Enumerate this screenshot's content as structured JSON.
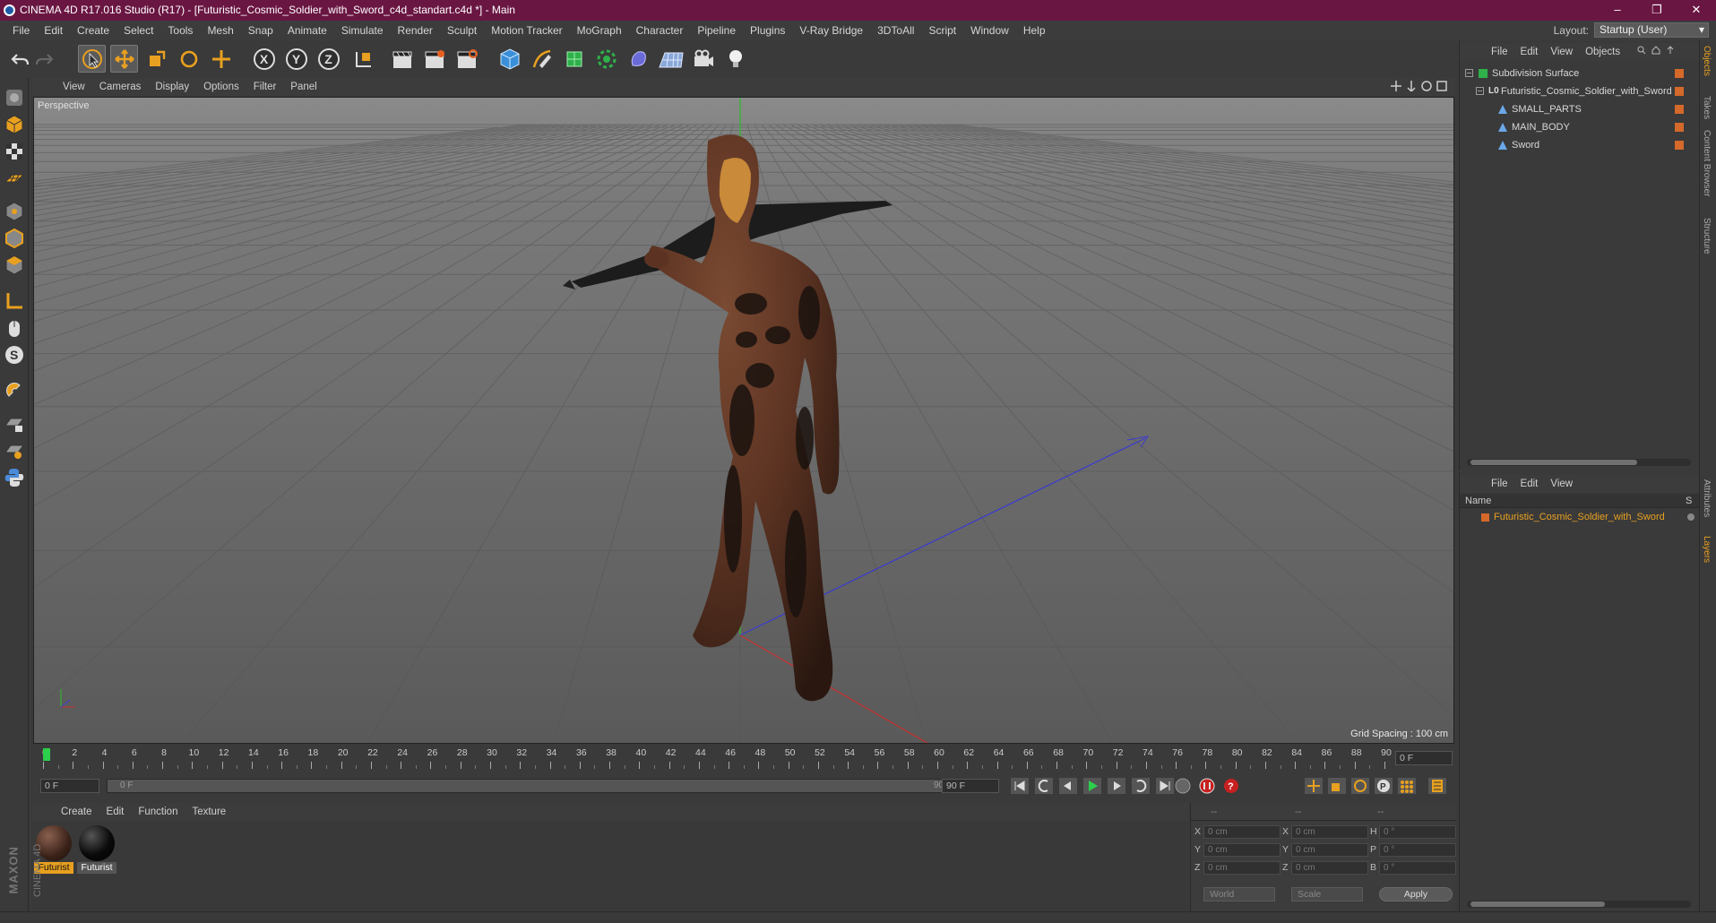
{
  "window": {
    "title": "CINEMA 4D R17.016 Studio (R17) - [Futuristic_Cosmic_Soldier_with_Sword_c4d_standart.c4d *] - Main",
    "controls": [
      "–",
      "❐",
      "✕"
    ]
  },
  "menubar": [
    "File",
    "Edit",
    "Create",
    "Select",
    "Tools",
    "Mesh",
    "Snap",
    "Animate",
    "Simulate",
    "Render",
    "Sculpt",
    "Motion Tracker",
    "MoGraph",
    "Character",
    "Pipeline",
    "Plugins",
    "V-Ray Bridge",
    "3DToAll",
    "Script",
    "Window",
    "Help"
  ],
  "layout": {
    "label": "Layout:",
    "value": "Startup (User)"
  },
  "toolbar": {
    "axis_x": "X",
    "axis_y": "Y",
    "axis_z": "Z"
  },
  "viewport": {
    "menu": [
      "View",
      "Cameras",
      "Display",
      "Options",
      "Filter",
      "Panel"
    ],
    "label": "Perspective",
    "grid_spacing": "Grid Spacing : 100 cm"
  },
  "timeline": {
    "ticks": [
      "0",
      "2",
      "4",
      "6",
      "8",
      "10",
      "12",
      "14",
      "16",
      "18",
      "20",
      "22",
      "24",
      "26",
      "28",
      "30",
      "32",
      "34",
      "36",
      "38",
      "40",
      "42",
      "44",
      "46",
      "48",
      "50",
      "52",
      "54",
      "56",
      "58",
      "60",
      "62",
      "64",
      "66",
      "68",
      "70",
      "72",
      "74",
      "76",
      "78",
      "80",
      "82",
      "84",
      "86",
      "88",
      "90"
    ],
    "current_frame": "0 F"
  },
  "anim": {
    "start": "0 F",
    "range_start": "0 F",
    "range_end": "90 F",
    "end": "90 F"
  },
  "materials": {
    "menu": [
      "Create",
      "Edit",
      "Function",
      "Texture"
    ],
    "items": [
      {
        "label": "Futurist",
        "selected": true
      },
      {
        "label": "Futurist",
        "selected": false
      }
    ]
  },
  "coords": {
    "header": [
      "--",
      "--",
      "--"
    ],
    "rows": [
      {
        "a": "X",
        "av": "0 cm",
        "b": "X",
        "bv": "0 cm",
        "c": "H",
        "cv": "0 °"
      },
      {
        "a": "Y",
        "av": "0 cm",
        "b": "Y",
        "bv": "0 cm",
        "c": "P",
        "cv": "0 °"
      },
      {
        "a": "Z",
        "av": "0 cm",
        "b": "Z",
        "bv": "0 cm",
        "c": "B",
        "cv": "0 °"
      }
    ],
    "world": "World",
    "scale": "Scale",
    "apply": "Apply"
  },
  "objects": {
    "menu": [
      "File",
      "Edit",
      "View",
      "Objects"
    ],
    "items": [
      {
        "name": "Subdivision Surface",
        "level": 0
      },
      {
        "name": "Futuristic_Cosmic_Soldier_with_Sword",
        "level": 1
      },
      {
        "name": "SMALL_PARTS",
        "level": 2
      },
      {
        "name": "MAIN_BODY",
        "level": 2
      },
      {
        "name": "Sword",
        "level": 2
      }
    ]
  },
  "layers": {
    "menu": [
      "File",
      "Edit",
      "View"
    ],
    "col_name": "Name",
    "col_s": "S",
    "item": "Futuristic_Cosmic_Soldier_with_Sword"
  },
  "right_tabs": [
    "Objects",
    "Takes",
    "Content Browser",
    "Structure",
    "Attributes",
    "Layers"
  ],
  "brand": {
    "maxon": "MAXON",
    "c4d": "CINEMA 4D"
  },
  "colors": {
    "title_bg": "#6a1642",
    "accent_orange": "#e8a020",
    "tag_orange": "#d4692a"
  }
}
